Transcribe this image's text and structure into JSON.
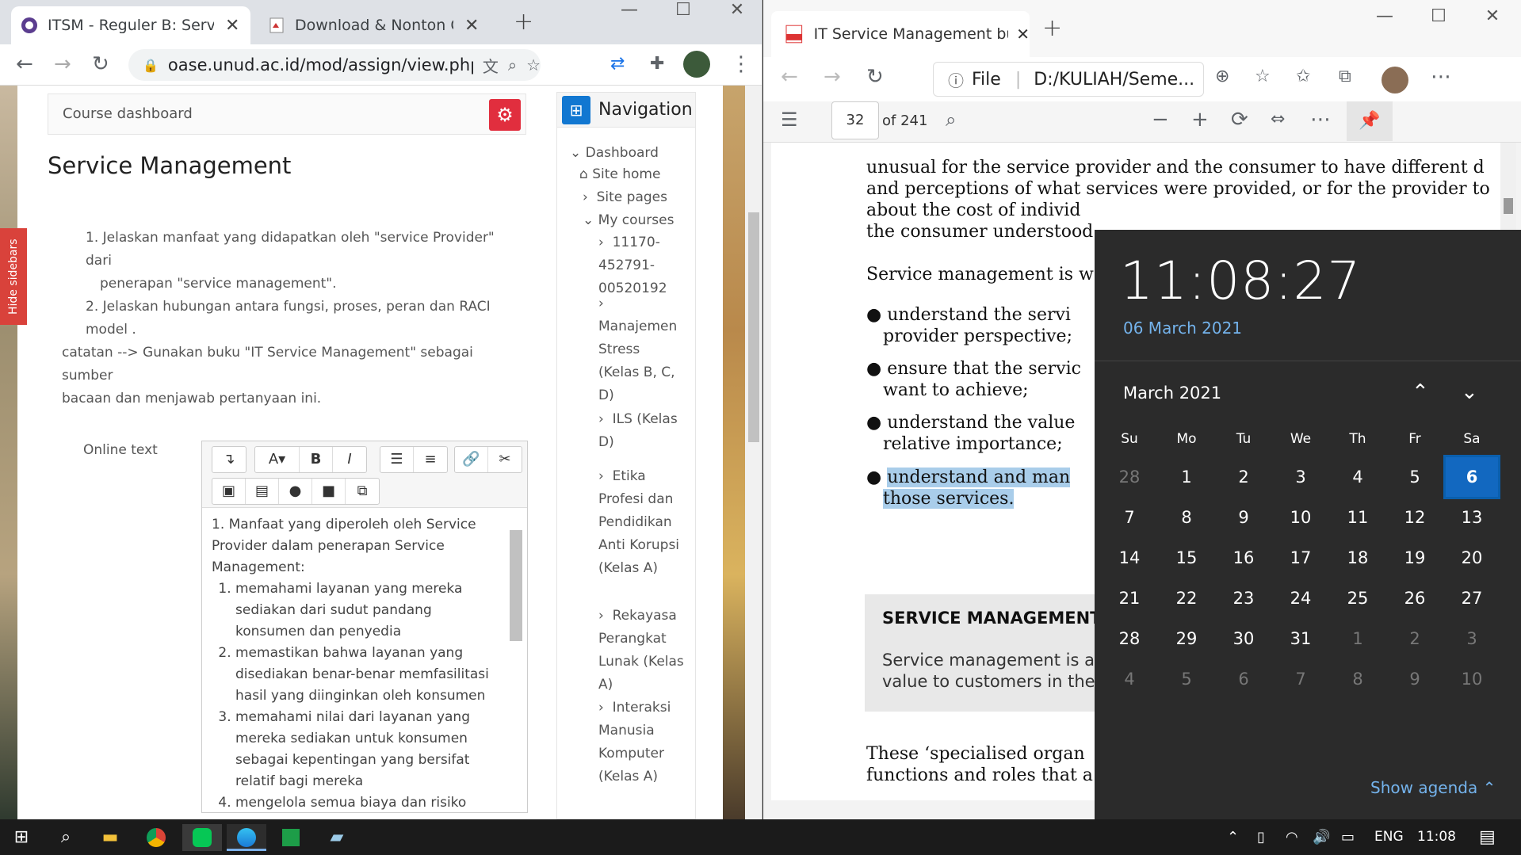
{
  "chrome": {
    "tabs": [
      {
        "title": "ITSM - Reguler B: Service M",
        "active": true
      },
      {
        "title": "Download & Nonton Cek",
        "active": false
      }
    ],
    "url": "oase.unud.ac.id/mod/assign/view.php?i...",
    "hide_sidebars": "Hide sidebars",
    "course_dashboard": "Course dashboard",
    "page_title": "Service Management",
    "task_lines": [
      "1. Jelaskan manfaat yang didapatkan oleh \"service Provider\" dari",
      "penerapan \"service management\".",
      "2. Jelaskan hubungan antara fungsi, proses, peran dan RACI model .",
      "catatan --> Gunakan buku \"IT Service Management\" sebagai sumber",
      "bacaan dan menjawab pertanyaan ini."
    ],
    "online_text_label": "Online text",
    "editor_text": {
      "intro": "1. Manfaat yang diperoleh oleh Service Provider dalam penerapan Service Management:",
      "items": [
        "memahami layanan yang mereka sediakan dari sudut pandang konsumen dan penyedia",
        "memastikan bahwa layanan yang disediakan benar-benar memfasilitasi hasil yang diinginkan oleh konsumen",
        "memahami nilai dari layanan yang mereka sediakan untuk konsumen sebagai kepentingan yang bersifat relatif bagi mereka",
        "mengelola semua biaya dan risiko"
      ]
    },
    "navigation": {
      "title": "Navigation",
      "dashboard": "Dashboard",
      "site_home": "Site home",
      "site_pages": "Site pages",
      "my_courses": "My courses",
      "courses": [
        [
          "11170-",
          "452791-",
          "00520192"
        ],
        [
          "",
          "Manajemen",
          "Stress",
          "(Kelas B, C,",
          "D)"
        ],
        [
          "ILS (Kelas",
          "D)"
        ],
        [
          "Etika",
          "Profesi dan",
          "Pendidikan",
          "Anti Korupsi",
          "(Kelas A)"
        ],
        [
          "Rekayasa",
          "Perangkat",
          "Lunak (Kelas",
          "A)"
        ],
        [
          "Interaksi",
          "Manusia",
          "Komputer",
          "(Kelas A)"
        ]
      ]
    }
  },
  "edge": {
    "tab_title": "IT Service Management bukuAja",
    "address_prefix": "File",
    "address": "D:/KULIAH/Seme...",
    "page_number": "32",
    "page_total": "of 241",
    "pdf_lines": [
      "unusual for the service provider and the consumer to have different d",
      "and perceptions of what services were provided, or for the provider to",
      "about the cost of individ",
      "the consumer understood",
      "Service management is w",
      "understand the servi",
      "provider perspective;",
      "ensure that the servic",
      "want to achieve;",
      "understand the value",
      "relative importance;",
      "understand and man",
      "those services.",
      "SERVICE MANAGEMENT",
      "Service management is a",
      "value to customers in the",
      "These ‘specialised organ",
      "functions and roles that a"
    ]
  },
  "calendar": {
    "time": "11:08:27",
    "date": "06 March 2021",
    "month": "March 2021",
    "weekdays": [
      "Su",
      "Mo",
      "Tu",
      "We",
      "Th",
      "Fr",
      "Sa"
    ],
    "weeks": [
      [
        "28",
        "1",
        "2",
        "3",
        "4",
        "5",
        "6"
      ],
      [
        "7",
        "8",
        "9",
        "10",
        "11",
        "12",
        "13"
      ],
      [
        "14",
        "15",
        "16",
        "17",
        "18",
        "19",
        "20"
      ],
      [
        "21",
        "22",
        "23",
        "24",
        "25",
        "26",
        "27"
      ],
      [
        "28",
        "29",
        "30",
        "31",
        "1",
        "2",
        "3"
      ],
      [
        "4",
        "5",
        "6",
        "7",
        "8",
        "9",
        "10"
      ]
    ],
    "today": "6",
    "show_agenda": "Show agenda"
  },
  "taskbar": {
    "language": "ENG",
    "time": "11:08"
  }
}
